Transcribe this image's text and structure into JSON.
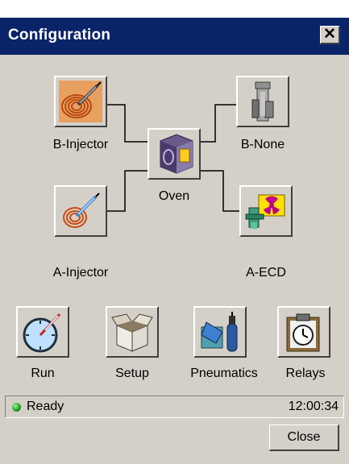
{
  "window": {
    "title": "Configuration",
    "close_glyph": "✕"
  },
  "components": {
    "b_injector": {
      "label": "B-Injector",
      "icon": "injector-icon"
    },
    "b_detector": {
      "label": "B-None",
      "icon": "empty-detector-icon"
    },
    "oven": {
      "label": "Oven",
      "icon": "oven-icon"
    },
    "a_injector": {
      "label": "A-Injector",
      "icon": "injector-icon"
    },
    "a_detector": {
      "label": "A-ECD",
      "icon": "ecd-radiation-icon"
    }
  },
  "toolbar": {
    "run": {
      "label": "Run",
      "icon": "stopwatch-syringe-icon"
    },
    "setup": {
      "label": "Setup",
      "icon": "box-icon"
    },
    "pneumatics": {
      "label": "Pneumatics",
      "icon": "gas-cylinder-icon"
    },
    "relays": {
      "label": "Relays",
      "icon": "clipboard-stopwatch-icon"
    }
  },
  "status": {
    "text": "Ready",
    "time": "12:00:34",
    "indicator_color": "#1a9a1a"
  },
  "footer": {
    "close_label": "Close"
  },
  "colors": {
    "titlebar": "#0a246a",
    "window": "#d4d0c8"
  }
}
